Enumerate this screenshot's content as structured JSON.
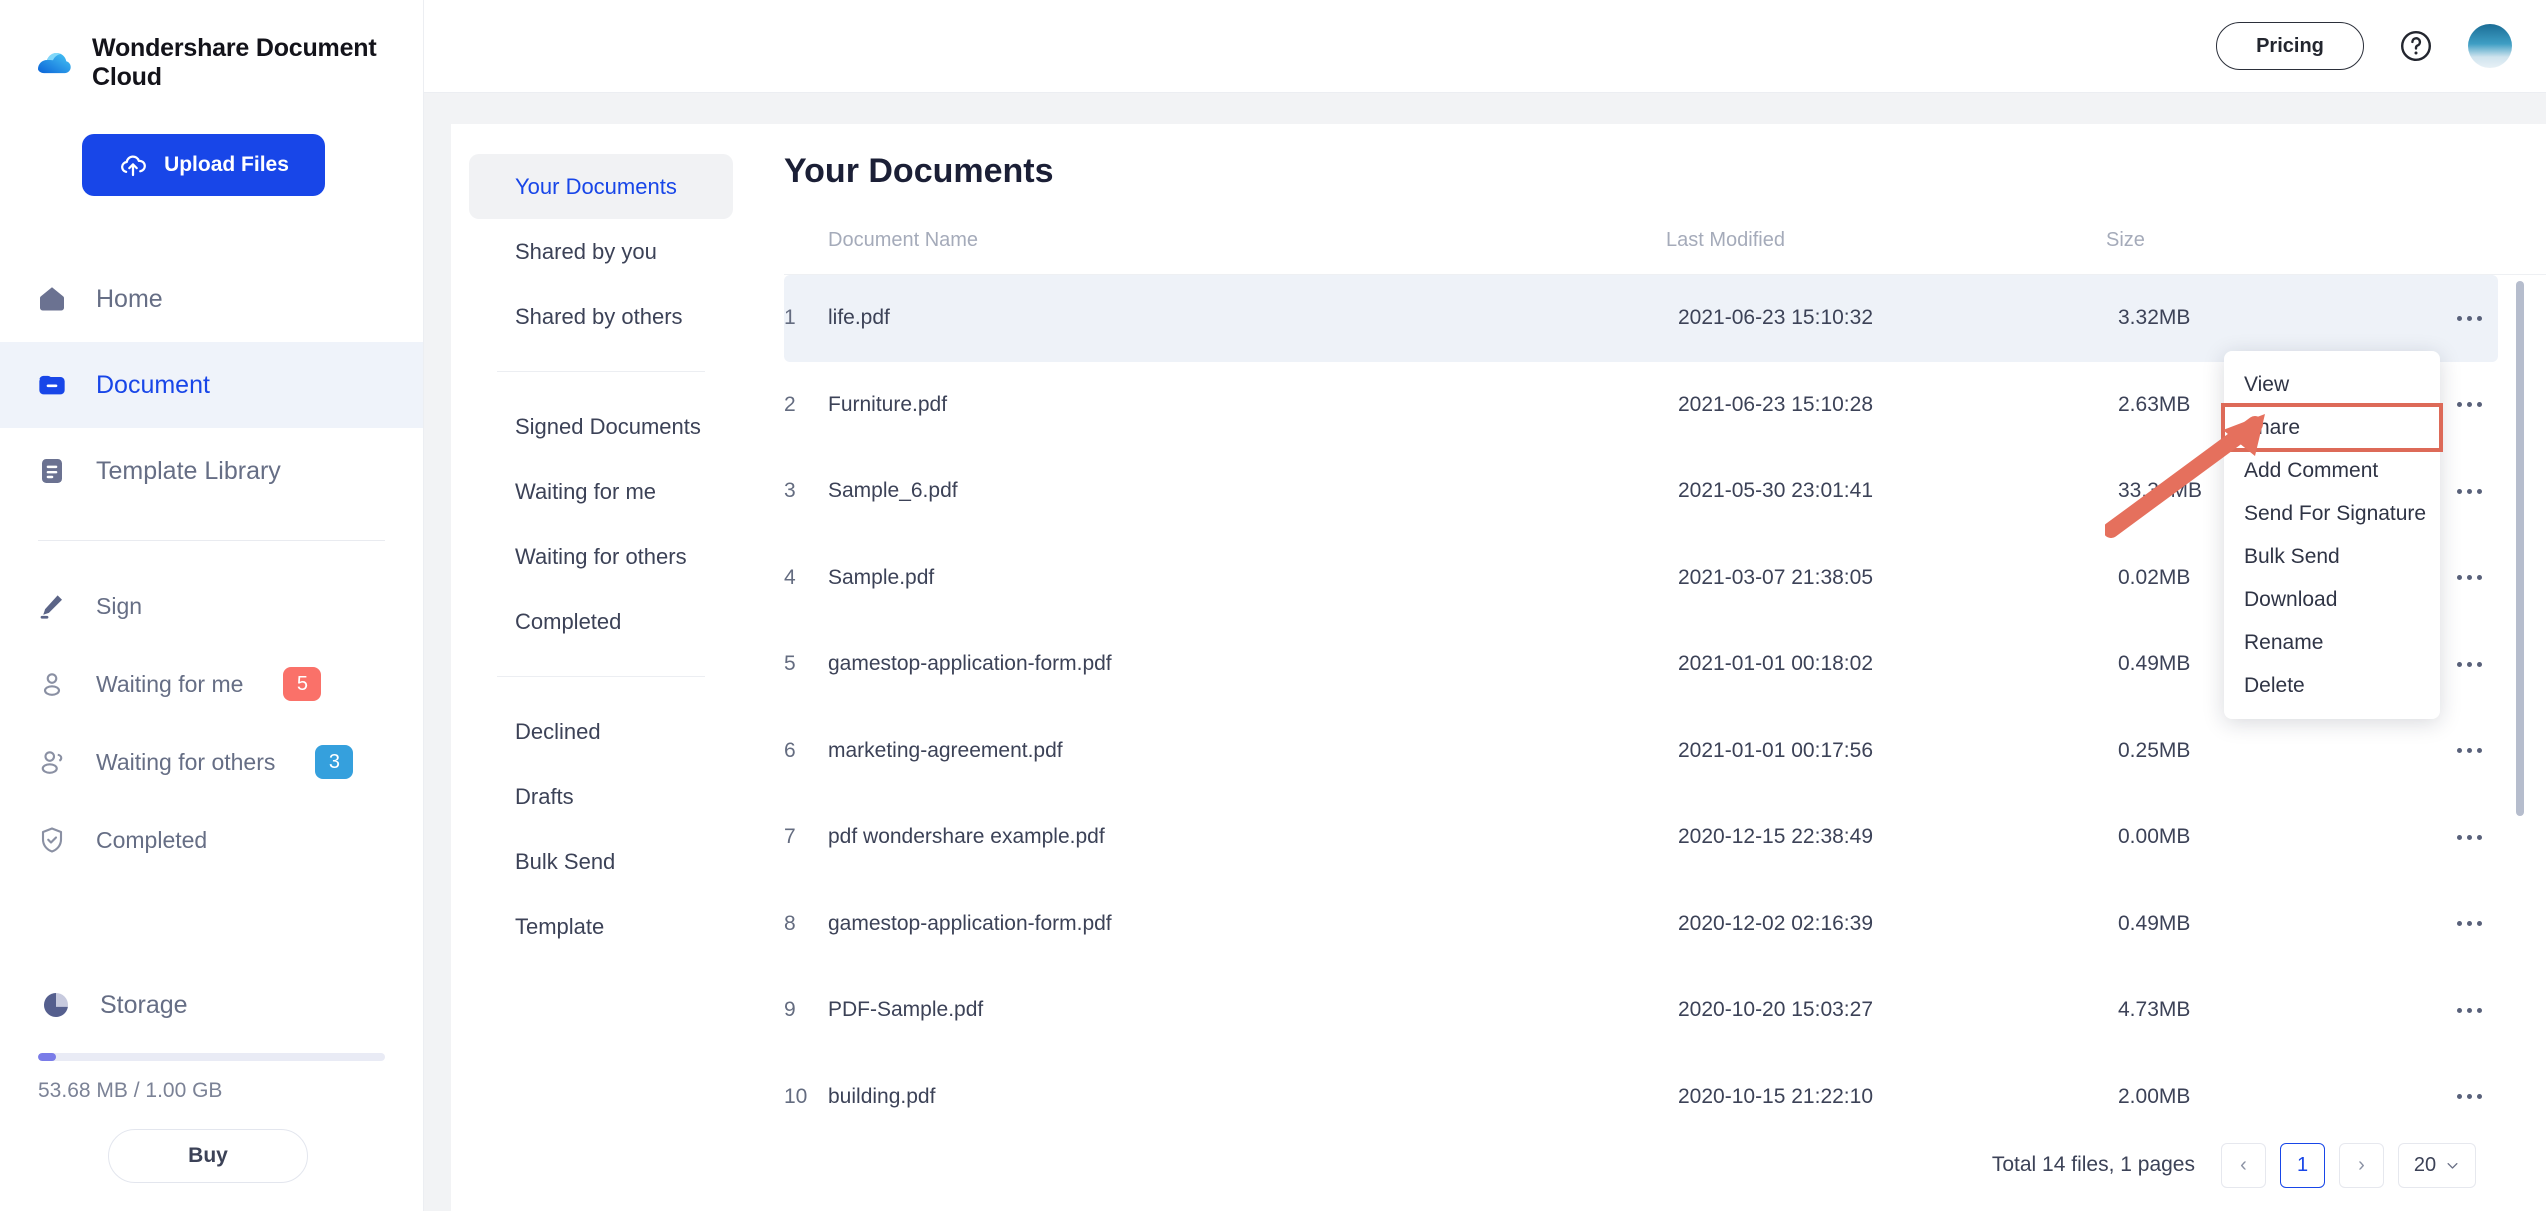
{
  "brand": {
    "title": "Wondershare Document Cloud",
    "logo_icon": "cloud-logo-icon"
  },
  "upload": {
    "label": "Upload Files",
    "icon": "cloud-upload-icon"
  },
  "sidebar": {
    "primary": [
      {
        "label": "Home",
        "icon": "home-icon",
        "active": false
      },
      {
        "label": "Document",
        "icon": "folder-icon",
        "active": true
      },
      {
        "label": "Template Library",
        "icon": "template-document-icon",
        "active": false
      }
    ],
    "secondary": [
      {
        "label": "Sign",
        "icon": "pen-icon",
        "badge": null
      },
      {
        "label": "Waiting for me",
        "icon": "user-icon",
        "badge": "5",
        "badge_color": "#fa7169"
      },
      {
        "label": "Waiting for others",
        "icon": "users-icon",
        "badge": "3",
        "badge_color": "#35a0dd"
      },
      {
        "label": "Completed",
        "icon": "shield-check-icon",
        "badge": null
      }
    ],
    "storage": {
      "title": "Storage",
      "icon": "pie-chart-icon",
      "used_text": "53.68 MB / 1.00 GB",
      "percent": 5.2,
      "buy_label": "Buy"
    }
  },
  "topbar": {
    "pricing_label": "Pricing",
    "help_icon": "question-mark-circle-icon",
    "avatar_icon": "user-avatar"
  },
  "subnav": {
    "group1": [
      {
        "label": "Your Documents",
        "active": true
      },
      {
        "label": "Shared by you",
        "active": false
      },
      {
        "label": "Shared by others",
        "active": false
      }
    ],
    "group2": [
      {
        "label": "Signed Documents",
        "active": false
      },
      {
        "label": "Waiting for me",
        "active": false
      },
      {
        "label": "Waiting for others",
        "active": false
      },
      {
        "label": "Completed",
        "active": false
      }
    ],
    "group3": [
      {
        "label": "Declined",
        "active": false
      },
      {
        "label": "Drafts",
        "active": false
      },
      {
        "label": "Bulk Send",
        "active": false
      },
      {
        "label": "Template",
        "active": false
      }
    ]
  },
  "main": {
    "page_title": "Your Documents",
    "columns": {
      "index": "",
      "name": "Document Name",
      "modified": "Last Modified",
      "size": "Size",
      "actions": ""
    },
    "rows": [
      {
        "index": "1",
        "name": "life.pdf",
        "modified": "2021-06-23 15:10:32",
        "size": "3.32MB",
        "selected": true
      },
      {
        "index": "2",
        "name": "Furniture.pdf",
        "modified": "2021-06-23 15:10:28",
        "size": "2.63MB",
        "selected": false
      },
      {
        "index": "3",
        "name": "Sample_6.pdf",
        "modified": "2021-05-30 23:01:41",
        "size": "33.39MB",
        "selected": false
      },
      {
        "index": "4",
        "name": "Sample.pdf",
        "modified": "2021-03-07 21:38:05",
        "size": "0.02MB",
        "selected": false
      },
      {
        "index": "5",
        "name": "gamestop-application-form.pdf",
        "modified": "2021-01-01 00:18:02",
        "size": "0.49MB",
        "selected": false
      },
      {
        "index": "6",
        "name": "marketing-agreement.pdf",
        "modified": "2021-01-01 00:17:56",
        "size": "0.25MB",
        "selected": false
      },
      {
        "index": "7",
        "name": "pdf wondershare example.pdf",
        "modified": "2020-12-15 22:38:49",
        "size": "0.00MB",
        "selected": false
      },
      {
        "index": "8",
        "name": "gamestop-application-form.pdf",
        "modified": "2020-12-02 02:16:39",
        "size": "0.49MB",
        "selected": false
      },
      {
        "index": "9",
        "name": "PDF-Sample.pdf",
        "modified": "2020-10-20 15:03:27",
        "size": "4.73MB",
        "selected": false
      },
      {
        "index": "10",
        "name": "building.pdf",
        "modified": "2020-10-15 21:22:10",
        "size": "2.00MB",
        "selected": false
      }
    ]
  },
  "pagination": {
    "total_text": "Total 14 files, 1 pages",
    "prev_label": "‹",
    "next_label": "›",
    "current_page": "1",
    "page_size": "20"
  },
  "context_menu": {
    "items": [
      {
        "label": "View",
        "highlighted": false
      },
      {
        "label": "Share",
        "highlighted": true
      },
      {
        "label": "Add Comment",
        "highlighted": false
      },
      {
        "label": "Send For Signature",
        "highlighted": false
      },
      {
        "label": "Bulk Send",
        "highlighted": false
      },
      {
        "label": "Download",
        "highlighted": false
      },
      {
        "label": "Rename",
        "highlighted": false
      },
      {
        "label": "Delete",
        "highlighted": false
      }
    ]
  },
  "annotation": {
    "arrow_icon": "red-arrow-pointer",
    "color": "#e5705d",
    "highlight_color": "#dd6a58"
  }
}
